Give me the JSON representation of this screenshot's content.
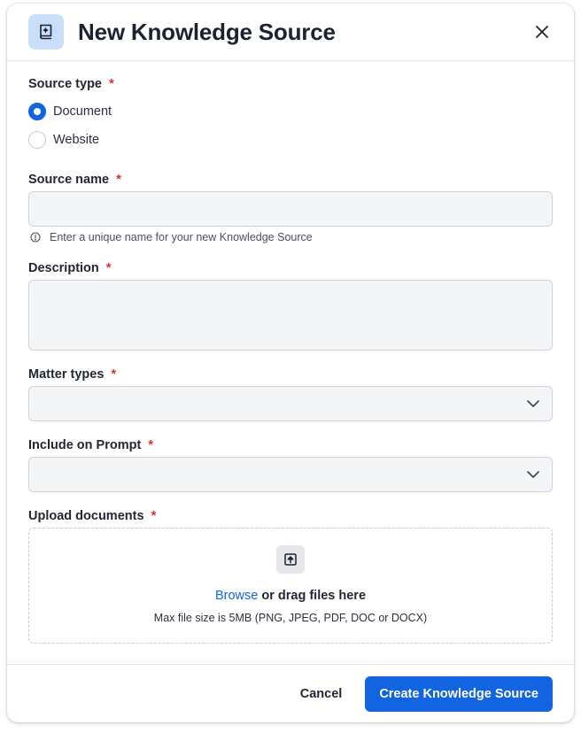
{
  "dialog": {
    "title": "New Knowledge Source",
    "header_icon": "book-sparkle-icon",
    "close_icon": "close-icon"
  },
  "source_type": {
    "label": "Source type",
    "required_mark": "*",
    "options": [
      {
        "label": "Document",
        "selected": true
      },
      {
        "label": "Website",
        "selected": false
      }
    ]
  },
  "source_name": {
    "label": "Source name",
    "required_mark": "*",
    "value": "",
    "hint": "Enter a unique name for your new Knowledge Source",
    "hint_icon": "info-icon"
  },
  "description": {
    "label": "Description",
    "required_mark": "*",
    "value": ""
  },
  "matter_types": {
    "label": "Matter types",
    "required_mark": "*",
    "selected": "",
    "chevron_icon": "chevron-down-icon"
  },
  "include_on_prompt": {
    "label": "Include on Prompt",
    "required_mark": "*",
    "selected": "",
    "chevron_icon": "chevron-down-icon"
  },
  "upload": {
    "label": "Upload documents",
    "required_mark": "*",
    "icon": "upload-icon",
    "browse_label": "Browse",
    "drag_text": "or drag files here",
    "limits": "Max file size is 5MB (PNG, JPEG, PDF, DOC or DOCX)"
  },
  "footer": {
    "cancel_label": "Cancel",
    "submit_label": "Create Knowledge Source"
  },
  "colors": {
    "accent": "#1264e0",
    "required": "#d9342b",
    "header_icon_bg": "#c9def8"
  }
}
